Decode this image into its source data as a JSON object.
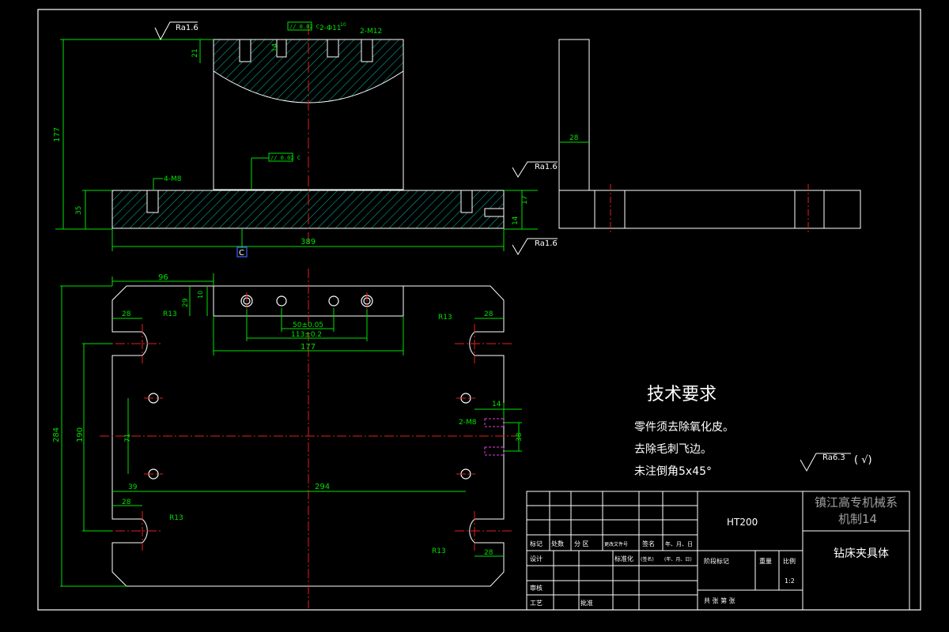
{
  "roughness": {
    "top": "Ra1.6",
    "right_top": "Ra1.6",
    "right_bottom": "Ra1.6",
    "general": "Ra6.3"
  },
  "callouts": {
    "flatness_top": "// 0.02 C",
    "flatness_mid": "// 0.02 C",
    "hole_2_d11": "2-Φ11",
    "hole_2_m12": "2-M12",
    "dim_10_top": "10",
    "datum": "C",
    "thread_4_m8": "4-M8",
    "thread_2_m8": "2-M8"
  },
  "dims": {
    "d177": "177",
    "d21": "21",
    "d14a": "14",
    "d35": "35",
    "d389": "389",
    "d28_side": "28",
    "d17": "17",
    "d14b": "14",
    "d96": "96",
    "d29": "29",
    "d10": "10",
    "d50": "50±0.05",
    "d113": "113±0.2",
    "d177b": "177",
    "d28a": "28",
    "r13a": "R13",
    "r13b": "R13",
    "d28b": "28",
    "d284": "284",
    "d190": "190",
    "d71": "71",
    "d39": "39",
    "d294": "294",
    "d28c": "28",
    "r13c": "R13",
    "r13d": "R13",
    "d28d": "28",
    "d14c": "14",
    "d38": "38"
  },
  "tech": {
    "title": "技术要求",
    "line1": "零件须去除氧化皮。",
    "line2": "去除毛刺飞边。",
    "line3": "未注倒角5x45°"
  },
  "title_block": {
    "material": "HT200",
    "school": "镇江高专机械系",
    "class": "机制14",
    "part_name": "钻床夹具体",
    "h_mark": "标记",
    "h_count": "处数",
    "h_zone": "分 区",
    "h_doc": "更改文件号",
    "h_sign": "签名",
    "h_date": "年、月、日",
    "h_design": "设计",
    "h_std": "标准化",
    "h_sign2": "(签名)",
    "h_date2": "(年、月、日)",
    "h_stage": "阶段标记",
    "h_weight": "重量",
    "h_scale": "比例",
    "scale": "1:2",
    "h_review": "审核",
    "h_process": "工艺",
    "h_approve": "批准",
    "h_sheets": "共    张    第    张"
  }
}
